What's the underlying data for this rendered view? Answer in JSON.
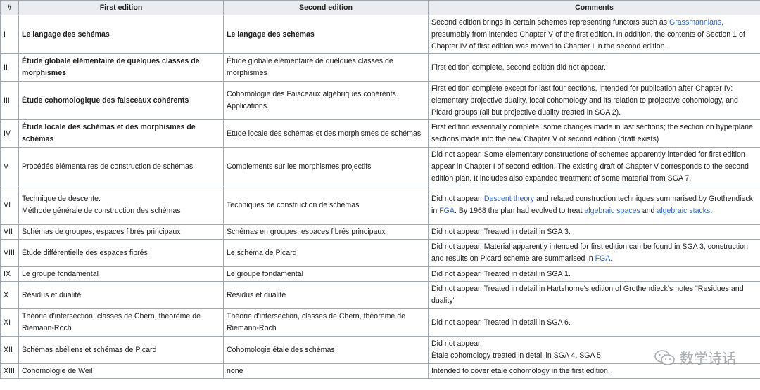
{
  "headers": {
    "num": "#",
    "first": "First edition",
    "second": "Second edition",
    "comments": "Comments"
  },
  "rows": [
    {
      "num": "I",
      "first": "Le langage des schémas",
      "first_bold": true,
      "second": "Le langage des schémas",
      "second_bold": true,
      "comments": [
        {
          "t": "Second edition brings in certain schemes representing functors such as "
        },
        {
          "t": "Grassmannians",
          "link": true
        },
        {
          "t": ", presumably from intended Chapter V of the first edition. In addition, the contents of Section 1 of Chapter IV of first edition was moved to Chapter I in the second edition."
        }
      ]
    },
    {
      "num": "II",
      "first": "Étude globale élémentaire de quelques classes de morphismes",
      "first_bold": true,
      "second": "Étude globale élémentaire de quelques classes de morphismes",
      "second_bold": false,
      "comments": [
        {
          "t": "First edition complete, second edition did not appear."
        }
      ]
    },
    {
      "num": "III",
      "first": "Étude cohomologique des faisceaux cohérents",
      "first_bold": true,
      "second": "Cohomologie des Faisceaux algébriques cohérents. Applications.",
      "second_bold": false,
      "comments": [
        {
          "t": "First edition complete except for last four sections, intended for publication after Chapter IV: elementary projective duality, local cohomology and its relation to projective cohomology, and Picard groups (all but projective duality treated in SGA 2)."
        }
      ]
    },
    {
      "num": "IV",
      "first": "Étude locale des schémas et des morphismes de schémas",
      "first_bold": true,
      "second": "Étude locale des schémas et des morphismes de schémas",
      "second_bold": false,
      "comments": [
        {
          "t": "First edition essentially complete; some changes made in last sections; the section on hyperplane sections made into the new Chapter V of second edition (draft exists)"
        }
      ]
    },
    {
      "num": "V",
      "first": "Procédés élémentaires de construction de schémas",
      "first_bold": false,
      "second": "Complements sur les morphismes projectifs",
      "second_bold": false,
      "comments": [
        {
          "t": "Did not appear. Some elementary constructions of schemes apparently intended for first edition appear in Chapter I of second edition. The existing draft of Chapter V corresponds to the second edition plan. It includes also expanded treatment of some material from SGA 7."
        }
      ]
    },
    {
      "num": "VI",
      "first": "Technique de descente.\nMéthode générale de construction des schémas",
      "first_bold": false,
      "second": "Techniques de construction de schémas",
      "second_bold": false,
      "comments": [
        {
          "t": "Did not appear. "
        },
        {
          "t": "Descent theory",
          "link": true
        },
        {
          "t": " and related construction techniques summarised by Grothendieck in "
        },
        {
          "t": "FGA",
          "link": true
        },
        {
          "t": ". By 1968 the plan had evolved to treat "
        },
        {
          "t": "algebraic spaces",
          "link": true
        },
        {
          "t": " and "
        },
        {
          "t": "algebraic stacks",
          "link": true
        },
        {
          "t": "."
        }
      ]
    },
    {
      "num": "VII",
      "first": "Schémas de groupes, espaces fibrés principaux",
      "first_bold": false,
      "second": "Schémas en groupes, espaces fibrés principaux",
      "second_bold": false,
      "comments": [
        {
          "t": "Did not appear. Treated in detail in SGA 3."
        }
      ]
    },
    {
      "num": "VIII",
      "first": "Étude différentielle des espaces fibrés",
      "first_bold": false,
      "second": "Le schéma de Picard",
      "second_bold": false,
      "comments": [
        {
          "t": "Did not appear. Material apparently intended for first edition can be found in SGA 3, construction and results on Picard scheme are summarised in "
        },
        {
          "t": "FGA",
          "link": true
        },
        {
          "t": "."
        }
      ]
    },
    {
      "num": "IX",
      "first": "Le groupe fondamental",
      "first_bold": false,
      "second": "Le groupe fondamental",
      "second_bold": false,
      "comments": [
        {
          "t": "Did not appear. Treated in detail in SGA 1."
        }
      ]
    },
    {
      "num": "X",
      "first": "Résidus et dualité",
      "first_bold": false,
      "second": "Résidus et dualité",
      "second_bold": false,
      "comments": [
        {
          "t": "Did not appear. Treated in detail in Hartshorne's edition of Grothendieck's notes \"Residues and duality\""
        }
      ]
    },
    {
      "num": "XI",
      "first": "Théorie d'intersection, classes de Chern, théorème de Riemann-Roch",
      "first_bold": false,
      "second": "Théorie d'intersection, classes de Chern, théorème de Riemann-Roch",
      "second_bold": false,
      "comments": [
        {
          "t": "Did not appear. Treated in detail in SGA 6."
        }
      ]
    },
    {
      "num": "XII",
      "first": "Schémas abéliens et schémas de Picard",
      "first_bold": false,
      "second": "Cohomologie étale des schémas",
      "second_bold": false,
      "comments": [
        {
          "t": "Did not appear.\nÉtale cohomology treated in detail in SGA 4, SGA 5."
        }
      ]
    },
    {
      "num": "XIII",
      "first": "Cohomologie de Weil",
      "first_bold": false,
      "second": "none",
      "second_bold": false,
      "comments": [
        {
          "t": "Intended to cover étale cohomology in the first edition."
        }
      ]
    }
  ],
  "watermark": {
    "text": "数学诗话",
    "icon": "wechat-icon"
  },
  "colors": {
    "header_bg": "#eaecf0",
    "border": "#a2a9b1",
    "link": "#3366cc",
    "text": "#202122"
  }
}
